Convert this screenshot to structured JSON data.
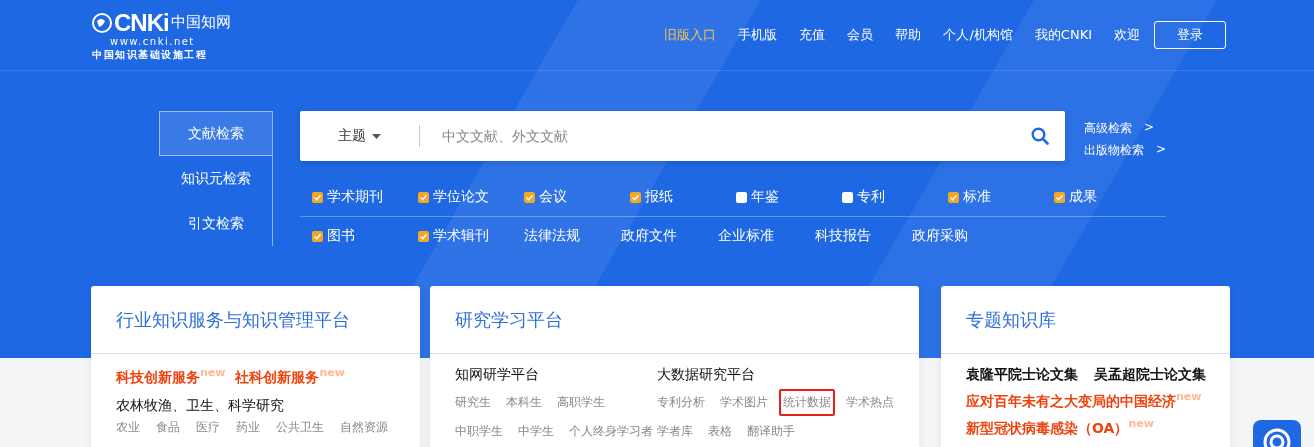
{
  "logo": {
    "mark": "CNKi",
    "name": "中国知网",
    "url": "www.cnki.net",
    "tagline": "中国知识基础设施工程"
  },
  "nav": [
    {
      "label": "旧版入口",
      "kind": "highlight"
    },
    {
      "label": "手机版",
      "kind": "plain"
    },
    {
      "label": "充值",
      "kind": "plain"
    },
    {
      "label": "会员",
      "kind": "plain"
    },
    {
      "label": "帮助",
      "kind": "plain"
    },
    {
      "label": "个人/机构馆",
      "kind": "plain"
    },
    {
      "label": "我的CNKI",
      "kind": "plain"
    },
    {
      "label": "欢迎",
      "kind": "text"
    }
  ],
  "login_button": "登录",
  "search_tabs": [
    {
      "label": "文献检索",
      "selected": true
    },
    {
      "label": "知识元检索",
      "selected": false
    },
    {
      "label": "引文检索",
      "selected": false
    }
  ],
  "search": {
    "field": "主题",
    "placeholder": "中文文献、外文文献"
  },
  "side_links": [
    {
      "label": "高级检索",
      "arrow": ">"
    },
    {
      "label": "出版物检索",
      "arrow": ">"
    }
  ],
  "resource_rows": [
    [
      {
        "label": "学术期刊",
        "kind": "checkbox",
        "checked": true
      },
      {
        "label": "学位论文",
        "kind": "checkbox",
        "checked": true
      },
      {
        "label": "会议",
        "kind": "checkbox",
        "checked": true
      },
      {
        "label": "报纸",
        "kind": "checkbox",
        "checked": true
      },
      {
        "label": "年鉴",
        "kind": "checkbox",
        "checked": false
      },
      {
        "label": "专利",
        "kind": "checkbox",
        "checked": false
      },
      {
        "label": "标准",
        "kind": "checkbox",
        "checked": true
      },
      {
        "label": "成果",
        "kind": "checkbox",
        "checked": true
      }
    ],
    [
      {
        "label": "图书",
        "kind": "checkbox",
        "checked": true
      },
      {
        "label": "学术辑刊",
        "kind": "checkbox",
        "checked": true
      },
      {
        "label": "法律法规",
        "kind": "link"
      },
      {
        "label": "政府文件",
        "kind": "link"
      },
      {
        "label": "企业标准",
        "kind": "link"
      },
      {
        "label": "科技报告",
        "kind": "link"
      },
      {
        "label": "政府采购",
        "kind": "link"
      }
    ]
  ],
  "cards": [
    {
      "title": "行业知识服务与知识管理平台",
      "kind": "industry",
      "services": [
        {
          "label": "科技创新服务",
          "badge": "new"
        },
        {
          "label": "社科创新服务",
          "badge": "new"
        }
      ],
      "heading": "农林牧渔、卫生、科学研究",
      "items": [
        "农业",
        "食品",
        "医疗",
        "药业",
        "公共卫生",
        "自然资源"
      ]
    },
    {
      "title": "研究学习平台",
      "kind": "study",
      "groups": [
        {
          "heading": "知网研学平台",
          "rows": [
            [
              {
                "label": "研究生",
                "highlighted": false
              },
              {
                "label": "本科生",
                "highlighted": false
              },
              {
                "label": "高职学生",
                "highlighted": false
              }
            ],
            [
              {
                "label": "中职学生",
                "highlighted": false
              },
              {
                "label": "中学生",
                "highlighted": false
              },
              {
                "label": "个人终身学习者",
                "highlighted": false
              }
            ]
          ]
        },
        {
          "heading": "大数据研究平台",
          "rows": [
            [
              {
                "label": "专利分析",
                "highlighted": false
              },
              {
                "label": "学术图片",
                "highlighted": false
              },
              {
                "label": "统计数据",
                "highlighted": true
              },
              {
                "label": "学术热点",
                "highlighted": false
              }
            ],
            [
              {
                "label": "学者库",
                "highlighted": false
              },
              {
                "label": "表格",
                "highlighted": false
              },
              {
                "label": "翻译助手",
                "highlighted": false
              }
            ]
          ]
        }
      ]
    },
    {
      "title": "专题知识库",
      "kind": "topic",
      "collections": [
        "袁隆平院士论文集",
        "吴孟超院士论文集"
      ],
      "links": [
        {
          "label": "应对百年未有之大变局的中国经济",
          "badge": "new"
        },
        {
          "label": "新型冠状病毒感染（OA）",
          "badge": "new"
        }
      ]
    }
  ]
}
